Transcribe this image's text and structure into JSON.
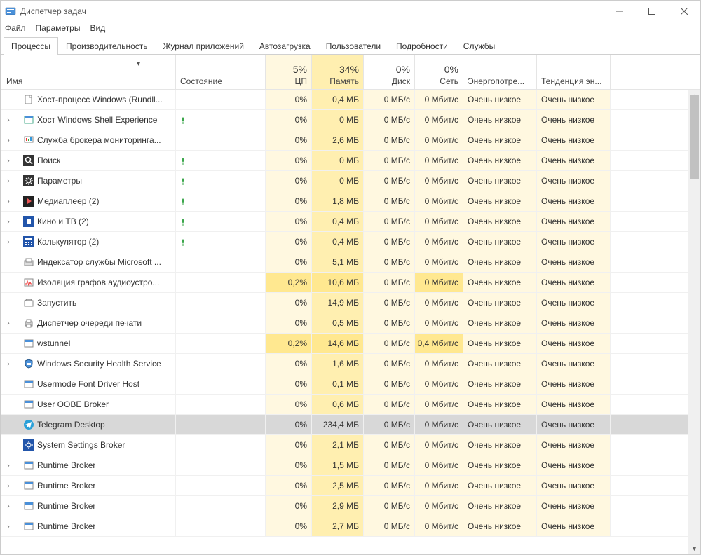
{
  "window": {
    "title": "Диспетчер задач"
  },
  "menu": {
    "file": "Файл",
    "options": "Параметры",
    "view": "Вид"
  },
  "tabs": {
    "processes": "Процессы",
    "performance": "Производительность",
    "app_history": "Журнал приложений",
    "startup": "Автозагрузка",
    "users": "Пользователи",
    "details": "Подробности",
    "services": "Службы"
  },
  "columns": {
    "name": "Имя",
    "status": "Состояние",
    "cpu": "ЦП",
    "cpu_pct": "5%",
    "memory": "Память",
    "memory_pct": "34%",
    "disk": "Диск",
    "disk_pct": "0%",
    "network": "Сеть",
    "network_pct": "0%",
    "energy": "Энергопотре...",
    "trend": "Тенденция эн..."
  },
  "common": {
    "very_low": "Очень низкое"
  },
  "rows": [
    {
      "name": "Хост-процесс Windows (Rundll...",
      "expand": false,
      "leaf": false,
      "cpu": "0%",
      "mem": "0,4 МБ",
      "disk": "0 МБ/с",
      "net": "0 Мбит/с",
      "ic": "page"
    },
    {
      "name": "Хост Windows Shell Experience",
      "expand": true,
      "leaf": true,
      "cpu": "0%",
      "mem": "0 МБ",
      "disk": "0 МБ/с",
      "net": "0 Мбит/с",
      "ic": "shell"
    },
    {
      "name": "Служба брокера мониторинга...",
      "expand": true,
      "leaf": false,
      "cpu": "0%",
      "mem": "2,6 МБ",
      "disk": "0 МБ/с",
      "net": "0 Мбит/с",
      "ic": "monitor"
    },
    {
      "name": "Поиск",
      "expand": true,
      "leaf": true,
      "cpu": "0%",
      "mem": "0 МБ",
      "disk": "0 МБ/с",
      "net": "0 Мбит/с",
      "ic": "search"
    },
    {
      "name": "Параметры",
      "expand": true,
      "leaf": true,
      "cpu": "0%",
      "mem": "0 МБ",
      "disk": "0 МБ/с",
      "net": "0 Мбит/с",
      "ic": "gear"
    },
    {
      "name": "Медиаплеер (2)",
      "expand": true,
      "leaf": true,
      "cpu": "0%",
      "mem": "1,8 МБ",
      "disk": "0 МБ/с",
      "net": "0 Мбит/с",
      "ic": "media"
    },
    {
      "name": "Кино и ТВ (2)",
      "expand": true,
      "leaf": true,
      "cpu": "0%",
      "mem": "0,4 МБ",
      "disk": "0 МБ/с",
      "net": "0 Мбит/с",
      "ic": "film"
    },
    {
      "name": "Калькулятор (2)",
      "expand": true,
      "leaf": true,
      "cpu": "0%",
      "mem": "0,4 МБ",
      "disk": "0 МБ/с",
      "net": "0 Мбит/с",
      "ic": "calc"
    },
    {
      "name": "Индексатор службы Microsoft ...",
      "expand": false,
      "leaf": false,
      "cpu": "0%",
      "mem": "5,1 МБ",
      "disk": "0 МБ/с",
      "net": "0 Мбит/с",
      "ic": "index"
    },
    {
      "name": "Изоляция графов аудиоустро...",
      "expand": false,
      "leaf": false,
      "cpu": "0,2%",
      "mem": "10,6 МБ",
      "disk": "0 МБ/с",
      "net": "0 Мбит/с",
      "ic": "audio",
      "hot": true
    },
    {
      "name": "Запустить",
      "expand": false,
      "leaf": false,
      "cpu": "0%",
      "mem": "14,9 МБ",
      "disk": "0 МБ/с",
      "net": "0 Мбит/с",
      "ic": "run"
    },
    {
      "name": "Диспетчер очереди печати",
      "expand": true,
      "leaf": false,
      "cpu": "0%",
      "mem": "0,5 МБ",
      "disk": "0 МБ/с",
      "net": "0 Мбит/с",
      "ic": "printer"
    },
    {
      "name": "wstunnel",
      "expand": false,
      "leaf": false,
      "cpu": "0,2%",
      "mem": "14,6 МБ",
      "disk": "0 МБ/с",
      "net": "0,4 Мбит/с",
      "ic": "exe",
      "hot": true
    },
    {
      "name": "Windows Security Health Service",
      "expand": true,
      "leaf": false,
      "cpu": "0%",
      "mem": "1,6 МБ",
      "disk": "0 МБ/с",
      "net": "0 Мбит/с",
      "ic": "shield"
    },
    {
      "name": "Usermode Font Driver Host",
      "expand": false,
      "leaf": false,
      "cpu": "0%",
      "mem": "0,1 МБ",
      "disk": "0 МБ/с",
      "net": "0 Мбит/с",
      "ic": "exe"
    },
    {
      "name": "User OOBE Broker",
      "expand": false,
      "leaf": false,
      "cpu": "0%",
      "mem": "0,6 МБ",
      "disk": "0 МБ/с",
      "net": "0 Мбит/с",
      "ic": "exe"
    },
    {
      "name": "Telegram Desktop",
      "expand": false,
      "leaf": false,
      "cpu": "0%",
      "mem": "234,4 МБ",
      "disk": "0 МБ/с",
      "net": "0 Мбит/с",
      "ic": "telegram",
      "selected": true
    },
    {
      "name": "System Settings Broker",
      "expand": false,
      "leaf": false,
      "cpu": "0%",
      "mem": "2,1 МБ",
      "disk": "0 МБ/с",
      "net": "0 Мбит/с",
      "ic": "geardark"
    },
    {
      "name": "Runtime Broker",
      "expand": true,
      "leaf": false,
      "cpu": "0%",
      "mem": "1,5 МБ",
      "disk": "0 МБ/с",
      "net": "0 Мбит/с",
      "ic": "exe"
    },
    {
      "name": "Runtime Broker",
      "expand": true,
      "leaf": false,
      "cpu": "0%",
      "mem": "2,5 МБ",
      "disk": "0 МБ/с",
      "net": "0 Мбит/с",
      "ic": "exe"
    },
    {
      "name": "Runtime Broker",
      "expand": true,
      "leaf": false,
      "cpu": "0%",
      "mem": "2,9 МБ",
      "disk": "0 МБ/с",
      "net": "0 Мбит/с",
      "ic": "exe"
    },
    {
      "name": "Runtime Broker",
      "expand": true,
      "leaf": false,
      "cpu": "0%",
      "mem": "2,7 МБ",
      "disk": "0 МБ/с",
      "net": "0 Мбит/с",
      "ic": "exe"
    }
  ]
}
